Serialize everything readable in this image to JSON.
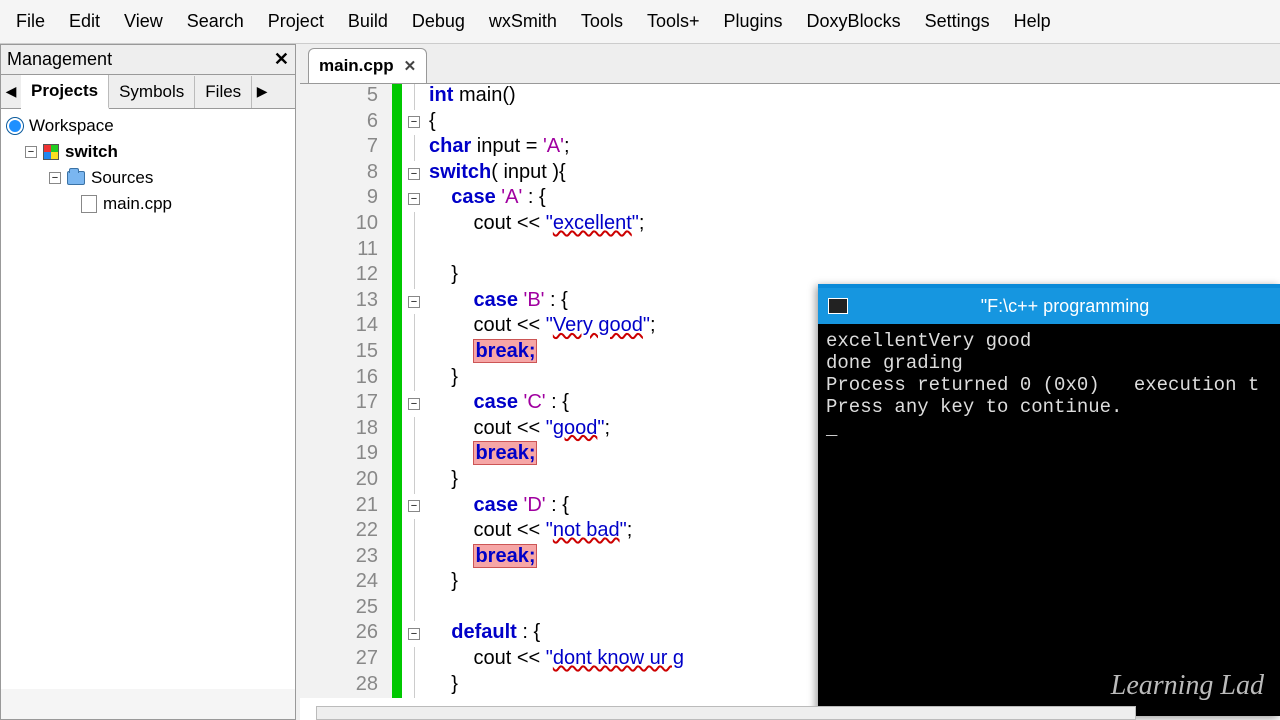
{
  "menu": {
    "items": [
      "File",
      "Edit",
      "View",
      "Search",
      "Project",
      "Build",
      "Debug",
      "wxSmith",
      "Tools",
      "Tools+",
      "Plugins",
      "DoxyBlocks",
      "Settings",
      "Help"
    ]
  },
  "mgmt": {
    "title": "Management",
    "tabs": {
      "projects": "Projects",
      "symbols": "Symbols",
      "files": "Files"
    },
    "tree": {
      "workspace": "Workspace",
      "project": "switch",
      "sources": "Sources",
      "file": "main.cpp"
    }
  },
  "editor": {
    "tab_label": "main.cpp",
    "tab_close": "✕",
    "lines": {
      "5a": "int",
      "5b": " main()",
      "6": "{",
      "7a": "char",
      "7b": " input = ",
      "7c": "'A'",
      "7d": ";",
      "8a": "switch",
      "8b": "( input ){",
      "9a": "    ",
      "9k": "case",
      "9b": " ",
      "9c": "'A'",
      "9d": " : {",
      "10a": "        cout << ",
      "10q": "\"",
      "10s": "excellent",
      "10q2": "\"",
      "10b": ";",
      "11": "",
      "12": "    }",
      "13a": "        ",
      "13k": "case",
      "13b": " ",
      "13c": "'B'",
      "13d": " : {",
      "14a": "        cout << ",
      "14q": "\"",
      "14s": "Very good",
      "14q2": "\"",
      "14b": ";",
      "15a": "        ",
      "15h": "break;",
      "16": "    }",
      "17a": "        ",
      "17k": "case",
      "17b": " ",
      "17c": "'C'",
      "17d": " : {",
      "18a": "        cout << ",
      "18q": "\"",
      "18s": "good",
      "18q2": "\"",
      "18b": ";",
      "19a": "        ",
      "19h": "break;",
      "20": "    }",
      "21a": "        ",
      "21k": "case",
      "21b": " ",
      "21c": "'D'",
      "21d": " : {",
      "22a": "        cout << ",
      "22q": "\"",
      "22s": "not bad",
      "22q2": "\"",
      "22b": ";",
      "23a": "        ",
      "23h": "break;",
      "24": "    }",
      "25": "",
      "26a": "    ",
      "26k": "default",
      "26b": " : {",
      "27a": "        cout << ",
      "27q": "\"",
      "27s": "dont know ur g",
      "27b": "",
      "28": "    }"
    },
    "linenums": {
      "5": "5",
      "6": "6",
      "7": "7",
      "8": "8",
      "9": "9",
      "10": "10",
      "11": "11",
      "12": "12",
      "13": "13",
      "14": "14",
      "15": "15",
      "16": "16",
      "17": "17",
      "18": "18",
      "19": "19",
      "20": "20",
      "21": "21",
      "22": "22",
      "23": "23",
      "24": "24",
      "25": "25",
      "26": "26",
      "27": "27",
      "28": "28"
    }
  },
  "console": {
    "title": "\"F:\\c++ programming",
    "out": "excellentVery good\ndone grading\nProcess returned 0 (0x0)   execution t\nPress any key to continue.\n_"
  },
  "watermark": "Learning Lad",
  "glyph": {
    "minus": "−",
    "close": "✕",
    "left": "◀",
    "right": "▶"
  }
}
